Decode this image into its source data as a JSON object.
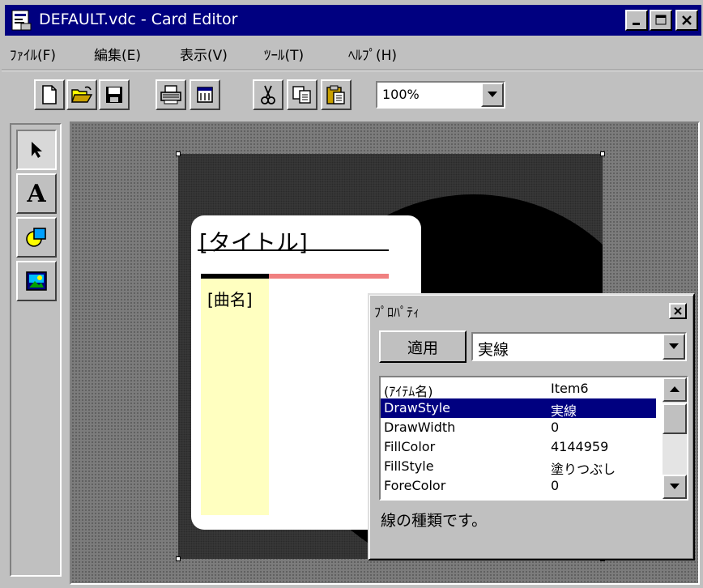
{
  "window": {
    "title": "DEFAULT.vdc - Card Editor",
    "caption_buttons": [
      "minimize-icon",
      "maximize-icon",
      "close-icon"
    ]
  },
  "menu": {
    "items": [
      {
        "label": "ﾌｧｲﾙ(F)"
      },
      {
        "label": "編集(E)"
      },
      {
        "label": "表示(V)"
      },
      {
        "label": "ﾂｰﾙ(T)"
      },
      {
        "label": "ﾍﾙﾌﾟ(H)"
      }
    ]
  },
  "toolbar": {
    "buttons": [
      "new-icon",
      "open-icon",
      "save-icon",
      "print-icon",
      "preview-icon",
      "cut-icon",
      "copy-icon",
      "paste-icon"
    ],
    "zoom": "100%"
  },
  "palette": {
    "tools": [
      "pointer-icon",
      "text-icon",
      "shape-icon",
      "image-icon"
    ],
    "text_tool_glyph": "A"
  },
  "card": {
    "title_placeholder": "[タイトル]",
    "song_placeholder": "[曲名]",
    "colors": {
      "background": "#3a3a3a",
      "circle": "#000000",
      "accent_bar": "#f08080",
      "column": "#ffffc0"
    }
  },
  "properties": {
    "title": "ﾌﾟﾛﾊﾟﾃｨ",
    "apply_label": "適用",
    "value_selected": "実線",
    "rows": [
      {
        "key": "(ｱｲﾃﾑ名)",
        "value": "Item6"
      },
      {
        "key": "DrawStyle",
        "value": "実線",
        "selected": true
      },
      {
        "key": "DrawWidth",
        "value": "0"
      },
      {
        "key": "FillColor",
        "value": "4144959"
      },
      {
        "key": "FillStyle",
        "value": "塗りつぶし"
      },
      {
        "key": "ForeColor",
        "value": "0"
      }
    ],
    "description": "線の種類です。"
  }
}
